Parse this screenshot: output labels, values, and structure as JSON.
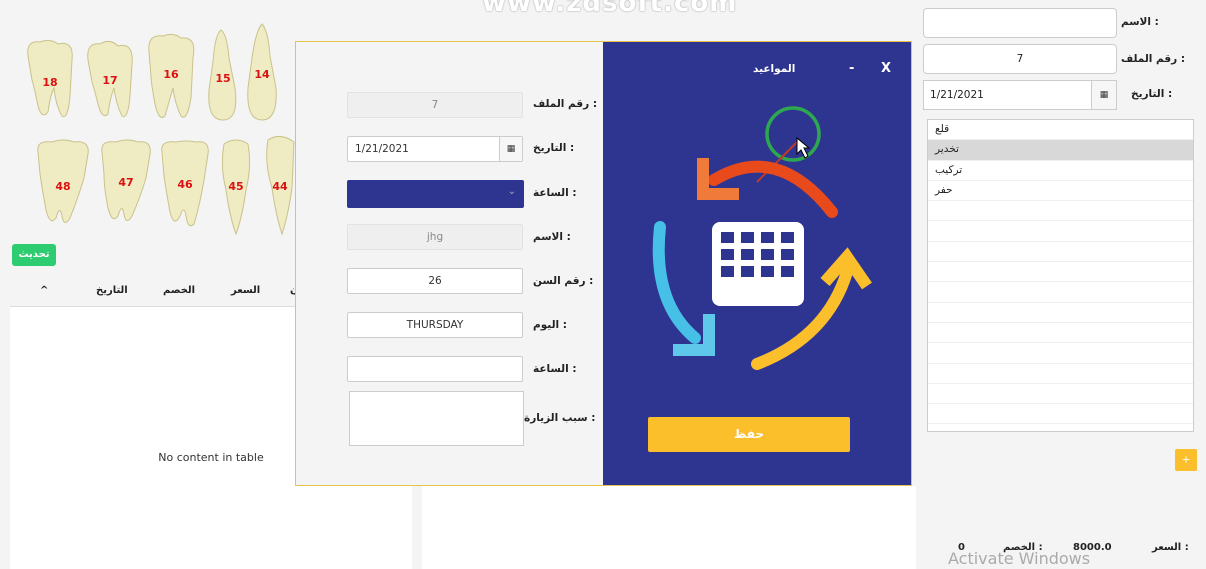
{
  "watermark": "www.zdsoft.com",
  "teeth": {
    "upper": [
      "18",
      "17",
      "16",
      "15",
      "14"
    ],
    "lower": [
      "48",
      "47",
      "46",
      "45",
      "44"
    ]
  },
  "refresh_button": "تحديث",
  "history_table": {
    "columns": [
      "^",
      "التاريخ",
      "الخصم",
      "السعر",
      "ن"
    ],
    "empty_text": "No content in table"
  },
  "modal": {
    "title": "المواعيد",
    "minimize": "-",
    "close": "X",
    "labels": {
      "file_no": "رقم الملف :",
      "date": "التاريخ :",
      "hour_select": "الساعة :",
      "name": "الاسم :",
      "tooth_no": "رقم السن :",
      "day": "اليوم :",
      "hour": "الساعة :",
      "visit_reason": "سبب الزيارة :"
    },
    "values": {
      "file_no": "7",
      "date": "1/21/2021",
      "name": "jhg",
      "tooth_no": "26",
      "day": "THURSDAY",
      "hour": "",
      "visit_reason": ""
    },
    "save_button": "حفظ"
  },
  "patient": {
    "labels": {
      "name": "الاسم :",
      "file_no": "رقم الملف :",
      "date": "التاريخ :"
    },
    "values": {
      "name": "",
      "file_no": "7",
      "date": "1/21/2021"
    },
    "procedures": [
      "قلع",
      "تخدير",
      "تركيب",
      "حفر"
    ],
    "selected_procedure": "تخدير",
    "add_button": "+"
  },
  "totals": {
    "price_label": "السعر :",
    "price_value": "8000.0",
    "discount_label": "الخصم :",
    "discount_value": "0"
  },
  "os_watermark": "Activate Windows",
  "colors": {
    "modal_side": "#2e3590",
    "accent_yellow": "#fbbf2c",
    "refresh_green": "#2ecc71",
    "tooth_number_red": "#d11111"
  }
}
